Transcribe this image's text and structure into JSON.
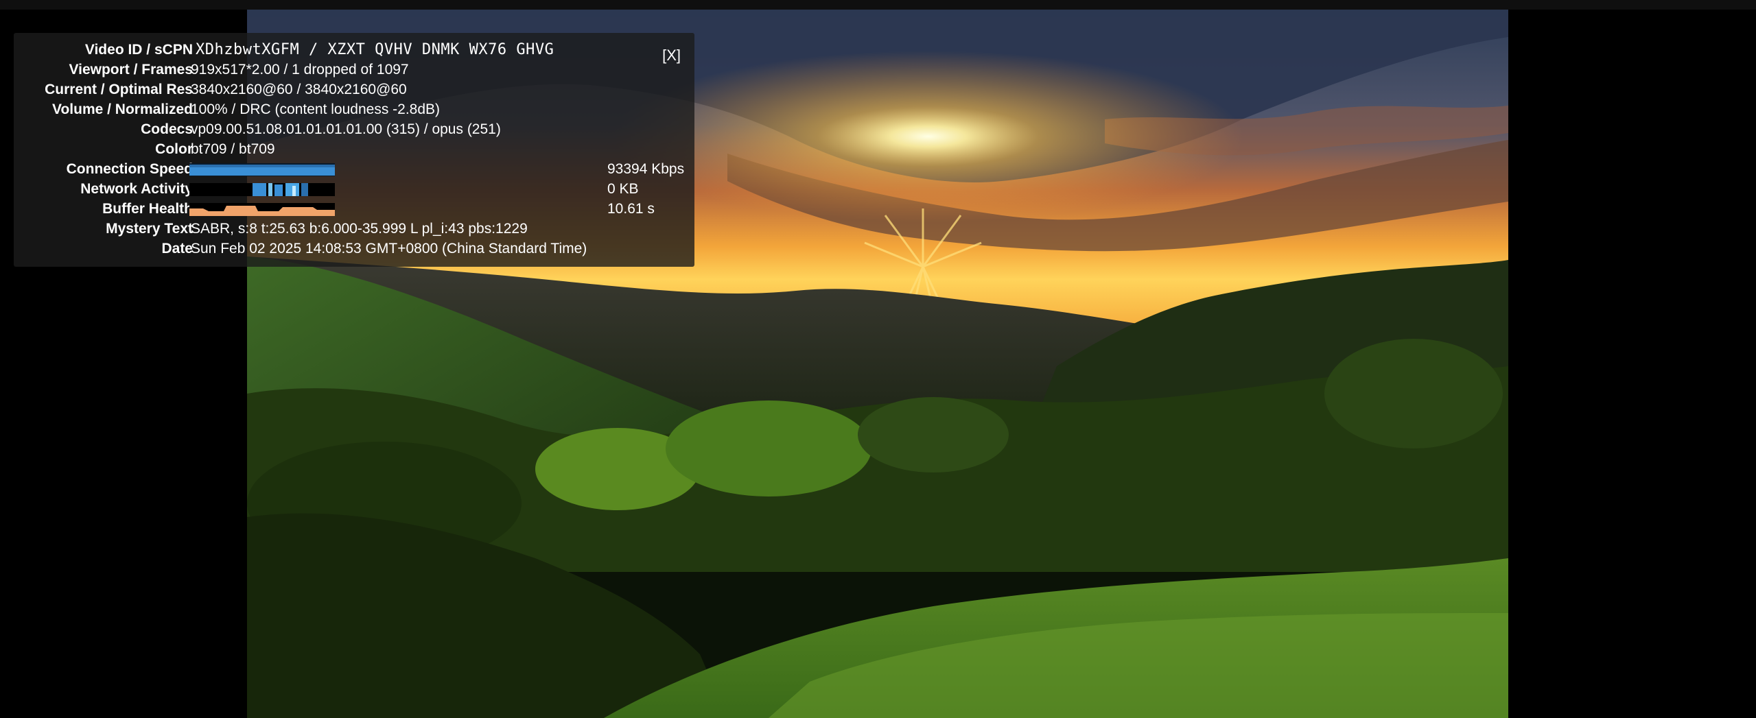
{
  "stats": {
    "close_label": "[X]",
    "rows": [
      {
        "label": "Video ID / sCPN",
        "value": "XDhzbwtXGFM / XZXT QVHV DNMK WX76 GHVG"
      },
      {
        "label": "Viewport / Frames",
        "value": "919x517*2.00 / 1 dropped of 1097"
      },
      {
        "label": "Current / Optimal Res",
        "value": "3840x2160@60 / 3840x2160@60"
      },
      {
        "label": "Volume / Normalized",
        "value": "100% / DRC (content loudness -2.8dB)"
      },
      {
        "label": "Codecs",
        "value": "vp09.00.51.08.01.01.01.01.00 (315) / opus (251)"
      },
      {
        "label": "Color",
        "value": "bt709 / bt709"
      },
      {
        "label": "Connection Speed",
        "value": "93394 Kbps"
      },
      {
        "label": "Network Activity",
        "value": "0 KB"
      },
      {
        "label": "Buffer Health",
        "value": "10.61 s"
      },
      {
        "label": "Mystery Text",
        "value": "SABR, s:8 t:25.63 b:6.000-35.999 L pl_i:43 pbs:1229"
      },
      {
        "label": "Date",
        "value": "Sun Feb 02 2025 14:08:53 GMT+0800 (China Standard Time)"
      }
    ]
  },
  "colors": {
    "connection_meter": "#3a8fd6",
    "network_meter": "#49a6e6",
    "buffer_meter": "#f0a36a",
    "panel_bg": "rgba(28,28,28,0.80)"
  }
}
